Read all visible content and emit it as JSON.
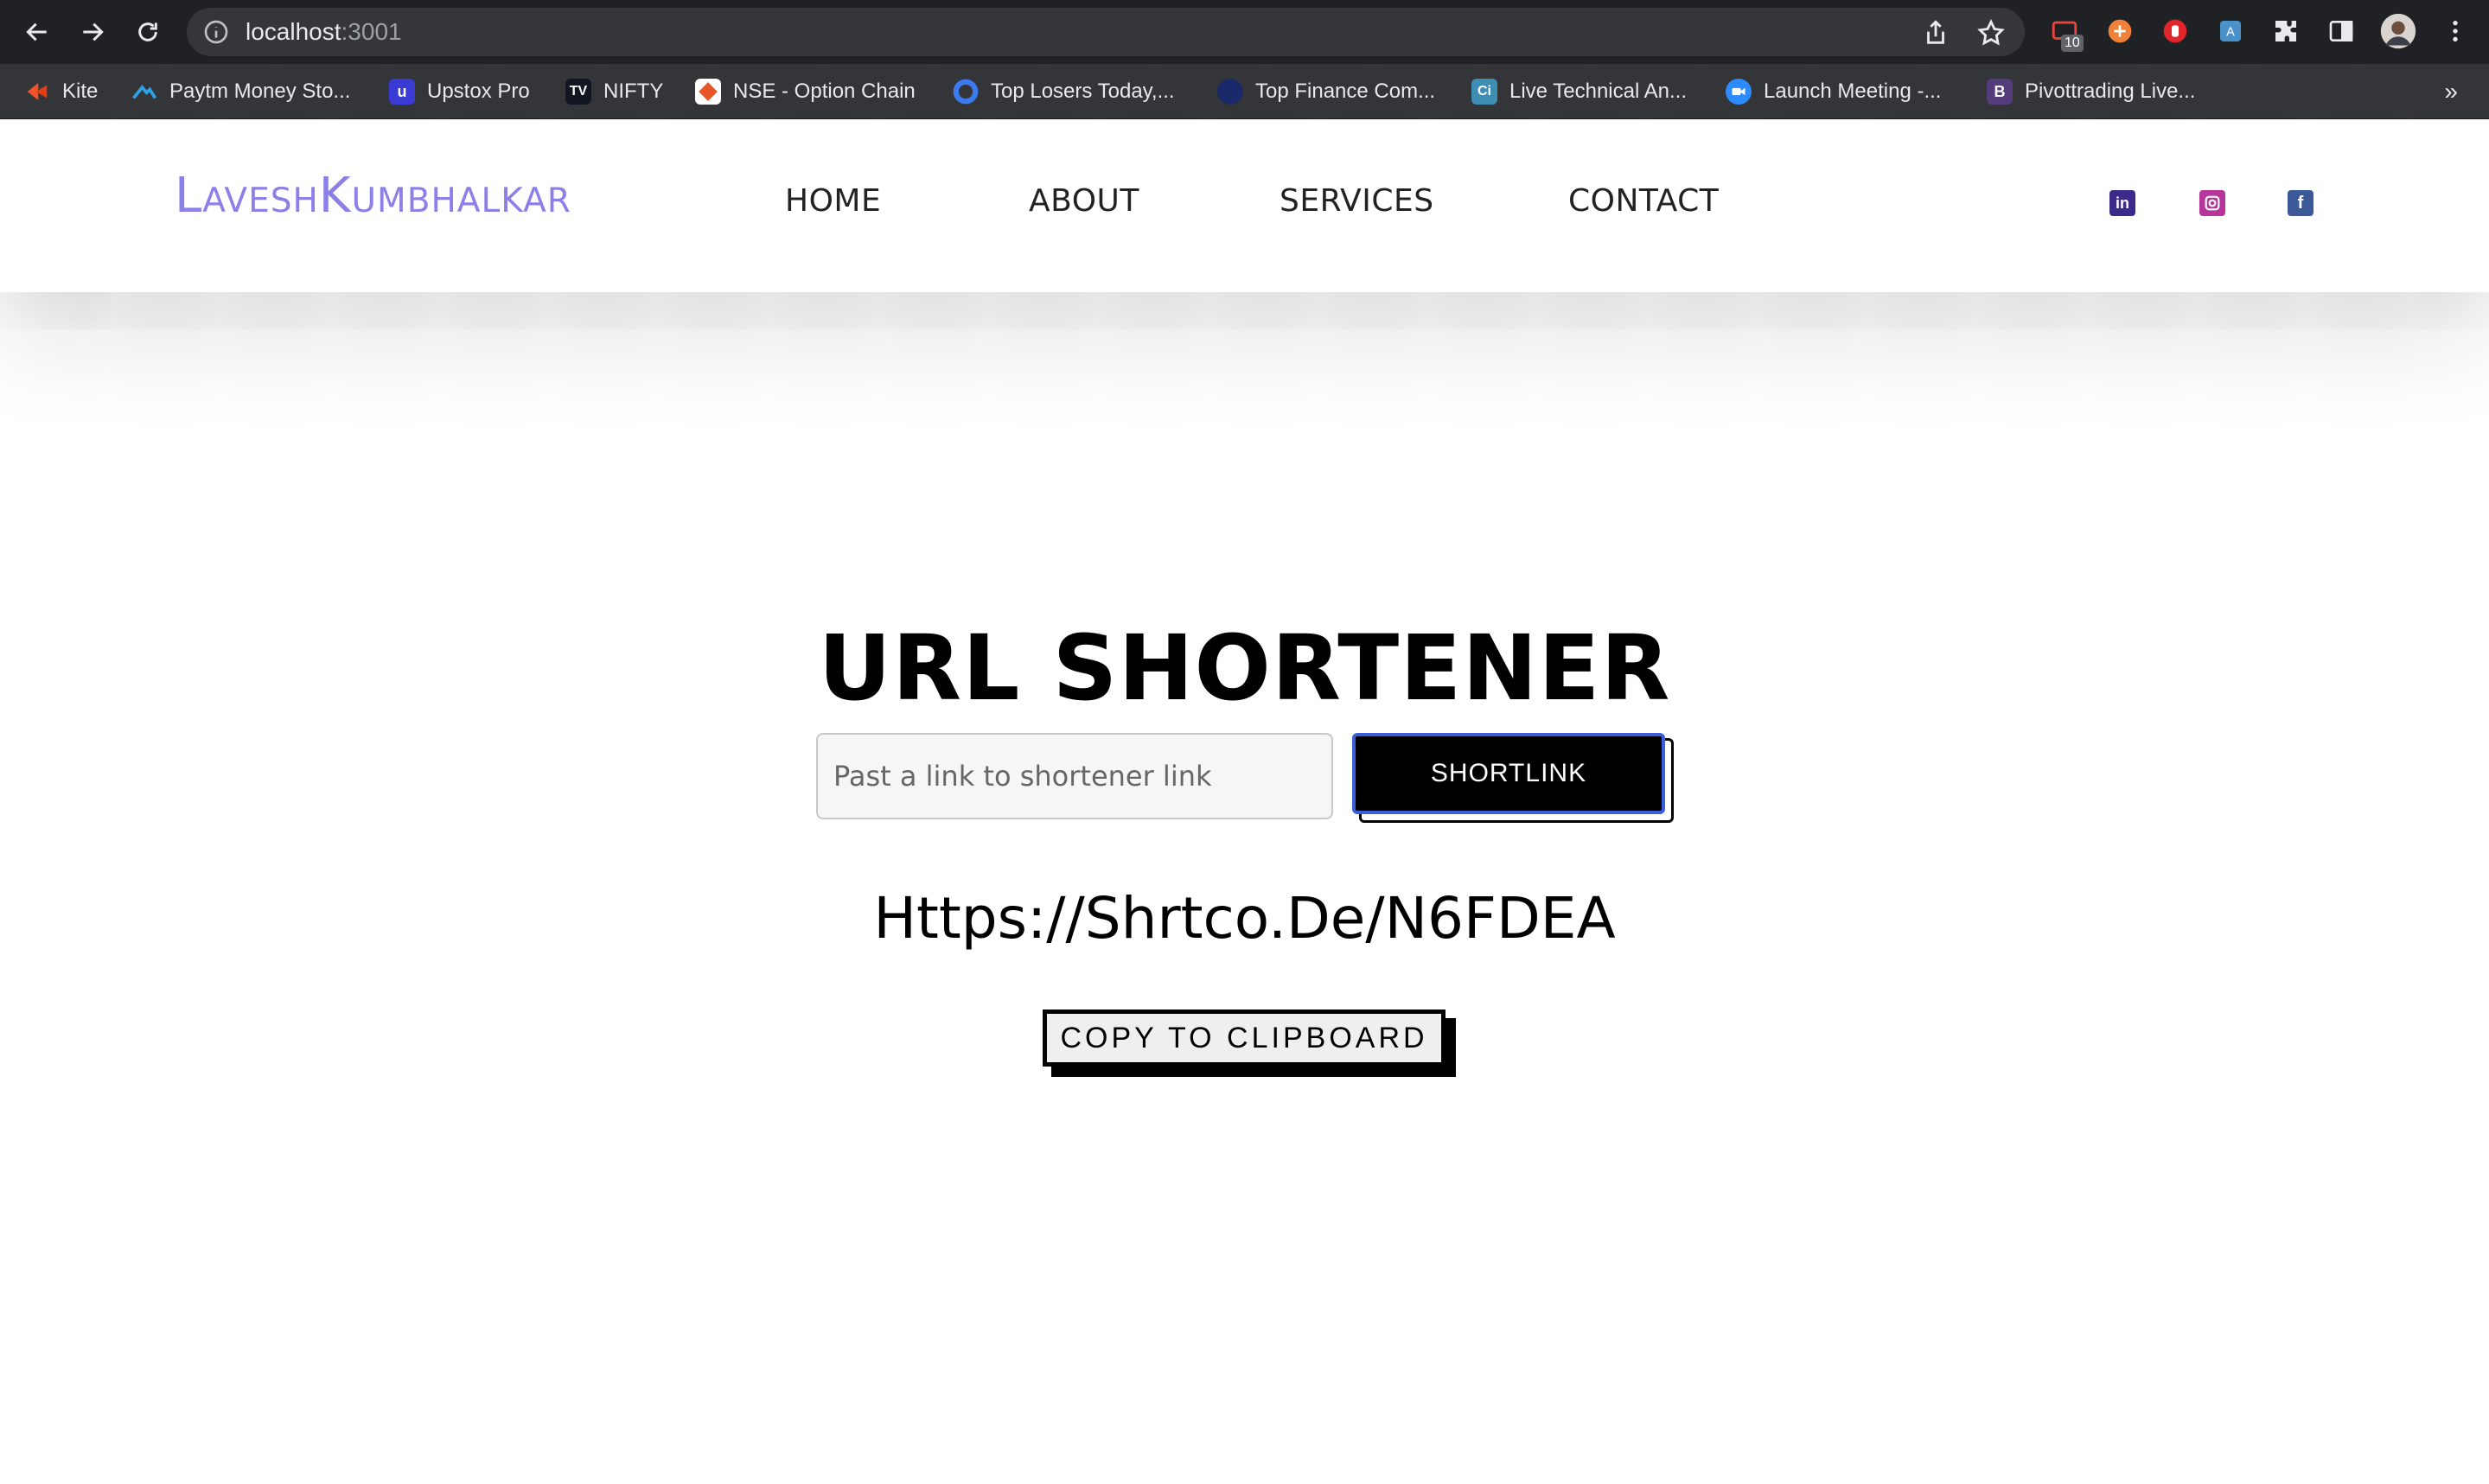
{
  "browser": {
    "url_host": "localhost",
    "url_port": ":3001",
    "extension_badge": "10",
    "bookmarks": [
      {
        "label": "Kite",
        "icon": "kite-icon",
        "color": "#f5542b"
      },
      {
        "label": "Paytm Money Sto...",
        "icon": "paytm-money-icon",
        "color": "#2fa3e8"
      },
      {
        "label": "Upstox Pro",
        "icon": "upstox-icon",
        "color": "#3b3bd6"
      },
      {
        "label": "NIFTY",
        "icon": "tradingview-icon",
        "color": "#131722"
      },
      {
        "label": "NSE - Option Chain",
        "icon": "nse-icon",
        "color": "#e8572a"
      },
      {
        "label": "Top Losers Today,...",
        "icon": "top-losers-icon",
        "color": "#3d7bf0"
      },
      {
        "label": "Top Finance Com...",
        "icon": "finance-icon",
        "color": "#1b2a6b"
      },
      {
        "label": "Live Technical An...",
        "icon": "investing-ci-icon",
        "color": "#3f8fb5"
      },
      {
        "label": "Launch Meeting -...",
        "icon": "zoom-icon",
        "color": "#2d8cff"
      },
      {
        "label": "Pivottrading Live...",
        "icon": "bootstrap-b-icon",
        "color": "#563d7c"
      }
    ]
  },
  "header": {
    "logo": "LaveshKumbhalkar",
    "nav": [
      "HOME",
      "ABOUT",
      "SERVICES",
      "CONTACT"
    ],
    "social": [
      {
        "name": "linkedin-icon",
        "color": "#3b2a8a"
      },
      {
        "name": "instagram-icon",
        "color": "#b5359a"
      },
      {
        "name": "facebook-icon",
        "color": "#3b5998"
      }
    ]
  },
  "main": {
    "title": "URL SHORTENER",
    "input_placeholder": "Past a link to shortener link",
    "input_value": "",
    "shorten_label": "SHORTLINK",
    "result": "Https://Shrtco.De/N6FDEA",
    "copy_label": "COPY TO CLIPBOARD"
  }
}
